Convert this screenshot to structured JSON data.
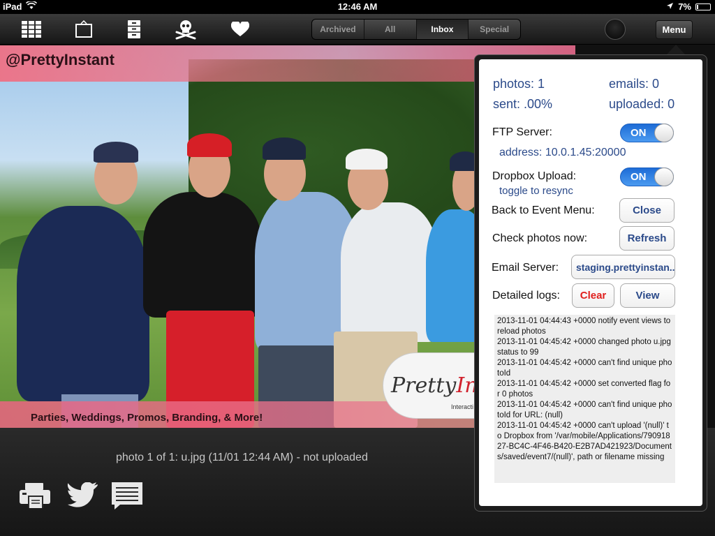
{
  "status_bar": {
    "device": "iPad",
    "time": "12:46 AM",
    "battery": "7%"
  },
  "toolbar": {
    "icons": [
      "grid-icon",
      "frame-icon",
      "cabinet-icon",
      "skull-icon",
      "heart-icon"
    ],
    "segments": [
      {
        "label": "Archived",
        "active": false
      },
      {
        "label": "All",
        "active": false
      },
      {
        "label": "Inbox",
        "active": true
      },
      {
        "label": "Special",
        "active": false
      }
    ],
    "menu_label": "Menu"
  },
  "photo": {
    "handle": "@PrettyInstant",
    "tagline": "Parties, Weddings, Promos, Branding, & More!",
    "logo_text_a": "Pretty",
    "logo_text_b": "In",
    "logo_sub": "Interacti"
  },
  "caption": "photo 1 of 1: u.jpg (11/01 12:44 AM) - not uploaded",
  "bottom_icons": [
    "print-icon",
    "twitter-icon",
    "message-icon"
  ],
  "panel": {
    "photos": "photos: 1",
    "emails": "emails: 0",
    "sent": "sent: .00%",
    "uploaded": "uploaded: 0",
    "ftp_label": "FTP Server:",
    "ftp_toggle": "ON",
    "address": "address: 10.0.1.45:20000",
    "dropbox_label": "Dropbox Upload:",
    "dropbox_toggle": "ON",
    "resync": "toggle to resync",
    "back_label": "Back to Event Menu:",
    "close_button": "Close",
    "check_label": "Check photos now:",
    "refresh_button": "Refresh",
    "email_label": "Email Server:",
    "email_server": "staging.prettyinstan...",
    "logs_label": "Detailed logs:",
    "clear_button": "Clear",
    "view_button": "View",
    "log_lines": [
      "2013-11-01 04:44:43 +0000 notify event views to reload photos",
      "2013-11-01 04:45:42 +0000 changed photo u.jpg status to 99",
      "2013-11-01 04:45:42 +0000 can't find unique photoId",
      "2013-11-01 04:45:42 +0000 set converted flag for 0 photos",
      "2013-11-01 04:45:42 +0000 can't find unique photoId for URL: (null)",
      "2013-11-01 04:45:42 +0000 can't upload '(null)' to Dropbox from '/var/mobile/Applications/79091827-BC4C-4F46-B420-E2B7AD421923/Documents/saved/event7/(null)', path or filename missing"
    ]
  },
  "colors": {
    "accent_blue": "#2b4a8a",
    "toggle_blue": "#1d6cd6",
    "clear_red": "#e0201e",
    "banner_pink": "#eb6e86"
  }
}
